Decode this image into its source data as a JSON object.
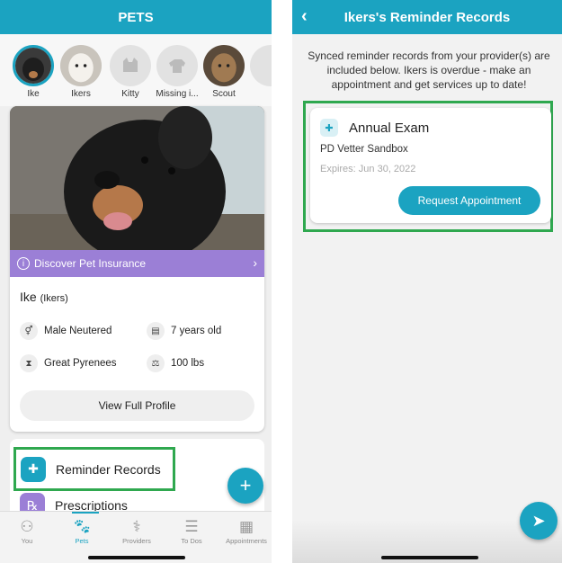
{
  "left_screen": {
    "title": "PETS",
    "pets": [
      {
        "name": "Ike"
      },
      {
        "name": "Ikers"
      },
      {
        "name": "Kitty"
      },
      {
        "name": "Missing i..."
      },
      {
        "name": "Scout"
      }
    ],
    "insurance_banner": "Discover Pet Insurance",
    "pet_name": "Ike",
    "pet_subname": "(Ikers)",
    "attributes": {
      "sex": "Male Neutered",
      "age": "7 years old",
      "breed": "Great Pyrenees",
      "weight": "100 lbs"
    },
    "view_profile_label": "View Full Profile",
    "menu": {
      "reminder_records": "Reminder Records",
      "prescriptions": "Prescriptions"
    },
    "tabs": {
      "you": "You",
      "pets": "Pets",
      "providers": "Providers",
      "todos": "To Dos",
      "appointments": "Appointments"
    }
  },
  "right_screen": {
    "title": "Ikers's Reminder Records",
    "intro": "Synced reminder records from your provider(s) are included below. Ikers is overdue - make an appointment and get services up to date!",
    "record": {
      "title": "Annual Exam",
      "provider": "PD Vetter Sandbox",
      "expires": "Expires: Jun 30, 2022",
      "button": "Request Appointment"
    }
  },
  "colors": {
    "brand": "#1ba3c1",
    "insurance": "#9b7fd6",
    "highlight": "#2fa84f"
  }
}
